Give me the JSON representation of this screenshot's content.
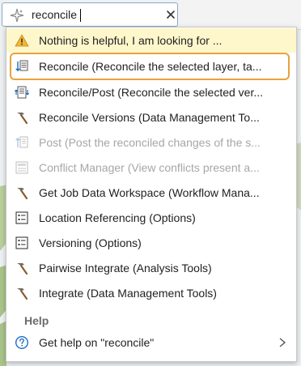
{
  "search": {
    "value": "reconcile",
    "clear_icon": "close-icon",
    "search_icon": "sparkle-search-icon"
  },
  "banner": {
    "label": "Nothing is helpful, I am looking for ...",
    "icon": "warning-icon"
  },
  "results": [
    {
      "label": "Reconcile (Reconcile the selected layer, ta...",
      "icon": "reconcile-icon",
      "enabled": true,
      "highlighted": true
    },
    {
      "label": "Reconcile/Post (Reconcile the selected ver...",
      "icon": "reconcile-post-icon",
      "enabled": true
    },
    {
      "label": "Reconcile Versions (Data Management To...",
      "icon": "hammer-tool-icon",
      "enabled": true
    },
    {
      "label": "Post (Post the reconciled changes of the s...",
      "icon": "post-icon",
      "enabled": false
    },
    {
      "label": "Conflict Manager (View conflicts present a...",
      "icon": "conflict-manager-icon",
      "enabled": false
    },
    {
      "label": "Get Job Data Workspace (Workflow Mana...",
      "icon": "hammer-tool-icon",
      "enabled": true
    },
    {
      "label": "Location Referencing (Options)",
      "icon": "options-icon",
      "enabled": true
    },
    {
      "label": "Versioning (Options)",
      "icon": "options-icon",
      "enabled": true
    },
    {
      "label": "Pairwise Integrate (Analysis Tools)",
      "icon": "hammer-tool-icon",
      "enabled": true
    },
    {
      "label": "Integrate (Data Management Tools)",
      "icon": "hammer-tool-icon",
      "enabled": true
    }
  ],
  "help": {
    "section_label": "Help",
    "label": "Get help on  \"reconcile\"",
    "icon": "help-icon",
    "chevron": "chevron-right-icon"
  },
  "colors": {
    "highlight_border": "#e8a33a",
    "banner_bg": "#fff7cc",
    "accent_blue": "#1d6fc4"
  }
}
